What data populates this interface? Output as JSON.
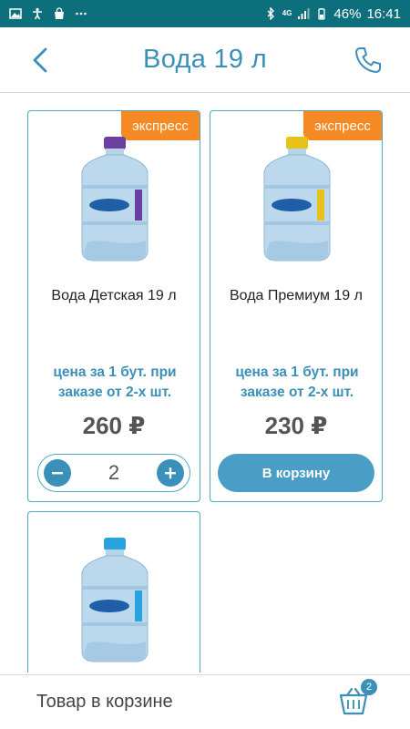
{
  "status_bar": {
    "network": "4G",
    "battery": "46%",
    "time": "16:41"
  },
  "header": {
    "title": "Вода 19 л"
  },
  "products": [
    {
      "name": "Вода Детская 19 л",
      "badge": "экспресс",
      "note": "цена за 1 бут. при заказе от 2-х шт.",
      "price": "260 ₽",
      "quantity": "2",
      "cap_color": "#6b3fa0",
      "label_color": "#6b3fa0"
    },
    {
      "name": "Вода Премиум 19 л",
      "badge": "экспресс",
      "note": "цена за 1 бут. при заказе от 2-х шт.",
      "price": "230 ₽",
      "cart_button": "В корзину",
      "cap_color": "#e7c21a",
      "label_color": "#e7c21a"
    },
    {
      "cap_color": "#29a3e0",
      "label_color": "#29a3e0"
    }
  ],
  "bottom_bar": {
    "label": "Товар в корзине",
    "cart_count": "2"
  },
  "colors": {
    "status_bar": "#0d6f7c",
    "accent": "#3a90b8",
    "badge": "#f58a24",
    "card_border": "#4fa9c4"
  },
  "icons": [
    "back-chevron-icon",
    "phone-icon",
    "minus-icon",
    "plus-icon",
    "cart-icon",
    "bottle-image"
  ]
}
